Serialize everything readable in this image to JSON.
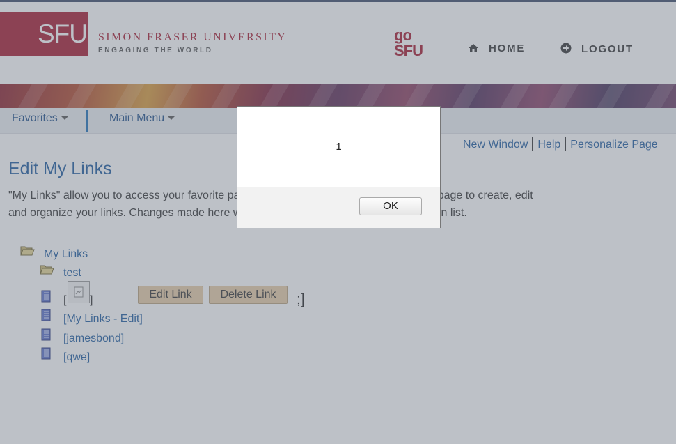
{
  "header": {
    "logo_text": "SFU",
    "university_name": "SIMON FRASER UNIVERSITY",
    "tagline": "ENGAGING THE WORLD",
    "gosfu_line1": "go",
    "gosfu_line2": "SFU",
    "home_label": "HOME",
    "logout_label": "LOGOUT"
  },
  "menubar": {
    "favorites_label": "Favorites",
    "main_menu_label": "Main Menu"
  },
  "toplinks": {
    "new_window": "New Window",
    "help": "Help",
    "personalize": "Personalize Page"
  },
  "page": {
    "title": "Edit My Links",
    "description": "\"My Links\" allow you to access your favorite pages quickly and easily. You can use this page to create, edit and organize your links. Changes made here will be reflected in the \"My Links\" dropdown list."
  },
  "tree": {
    "root_label": "My Links",
    "folder_label": "test",
    "item_prefix": "[",
    "item_suffix": "]",
    "edit_link_label": "Edit Link",
    "delete_link_label": "Delete Link",
    "trailing_text": ";]",
    "links": [
      "[My Links - Edit]",
      "[jamesbond]",
      "[qwe]"
    ]
  },
  "dialog": {
    "message": "1",
    "ok_label": "OK"
  },
  "colors": {
    "brand_red": "#a6192e",
    "link_blue": "#1d5a9e",
    "button_tan": "#e7cda6"
  }
}
